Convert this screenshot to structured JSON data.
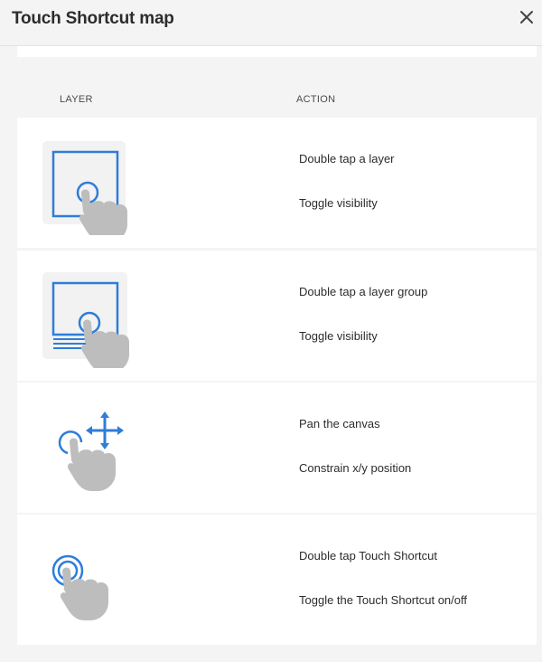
{
  "dialog": {
    "title": "Touch Shortcut map",
    "close_icon": "close-icon"
  },
  "columns": {
    "layer": "LAYER",
    "action": "ACTION"
  },
  "colors": {
    "accent_blue": "#2e7dd8",
    "hand_gray": "#bdbdbd",
    "background": "#f4f4f4",
    "row_background": "#ffffff"
  },
  "rows": [
    {
      "icon": "layer-double-tap-icon",
      "gesture": "Double tap a layer",
      "result": "Toggle visibility"
    },
    {
      "icon": "layer-group-double-tap-icon",
      "gesture": "Double tap a layer group",
      "result": "Toggle visibility"
    },
    {
      "icon": "pan-canvas-icon",
      "gesture": "Pan the canvas",
      "result": "Constrain x/y position"
    },
    {
      "icon": "touch-shortcut-double-tap-icon",
      "gesture": "Double tap Touch Shortcut",
      "result": "Toggle the Touch Shortcut on/off"
    }
  ]
}
